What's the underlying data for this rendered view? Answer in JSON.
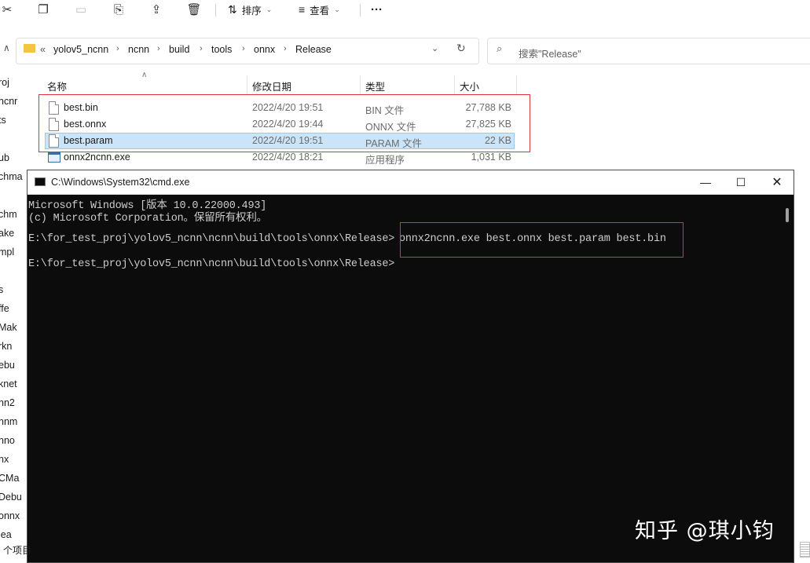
{
  "toolbar": {
    "sort_label": "排序",
    "view_label": "查看",
    "more_label": "···"
  },
  "address": {
    "crumbs": [
      "yolov5_ncnn",
      "ncnn",
      "build",
      "tools",
      "onnx",
      "Release"
    ],
    "overflow": "«",
    "search_placeholder": "搜索\"Release\""
  },
  "sidebar": {
    "items": [
      "roj",
      "ncnr",
      "ts",
      "",
      "ub",
      "chma",
      "",
      "chm",
      "ake",
      "mpl",
      "",
      "s",
      "ffe",
      "Mak",
      "rkn",
      "ebu",
      "knet",
      "nn2",
      "nnm",
      "nno",
      "nx",
      "CMa",
      "Debu",
      "onnx",
      "lea"
    ],
    "status": "个项目"
  },
  "columns": {
    "name": "名称",
    "modified": "修改日期",
    "type": "类型",
    "size": "大小"
  },
  "files": [
    {
      "name": "best.bin",
      "modified": "2022/4/20 19:51",
      "type": "BIN 文件",
      "size": "27,788 KB",
      "icon": "file-icon"
    },
    {
      "name": "best.onnx",
      "modified": "2022/4/20 19:44",
      "type": "ONNX 文件",
      "size": "27,825 KB",
      "icon": "file-icon"
    },
    {
      "name": "best.param",
      "modified": "2022/4/20 19:51",
      "type": "PARAM 文件",
      "size": "22 KB",
      "icon": "file-icon",
      "selected": true
    },
    {
      "name": "onnx2ncnn.exe",
      "modified": "2022/4/20 18:21",
      "type": "应用程序",
      "size": "1,031 KB",
      "icon": "exe-icon"
    }
  ],
  "cmd": {
    "title": "C:\\Windows\\System32\\cmd.exe",
    "lines": [
      "Microsoft Windows [版本 10.0.22000.493]",
      "(c) Microsoft Corporation。保留所有权利。",
      "",
      "E:\\for_test_proj\\yolov5_ncnn\\ncnn\\build\\tools\\onnx\\Release>",
      "",
      "E:\\for_test_proj\\yolov5_ncnn\\ncnn\\build\\tools\\onnx\\Release>"
    ],
    "command": "onnx2ncnn.exe best.onnx best.param best.bin"
  },
  "watermark": "知乎 @琪小钧",
  "colors": {
    "highlight_red": "#d9363e",
    "selection": "#cce4f7",
    "console_bg": "#0c0c0c",
    "console_text": "#cccccc"
  }
}
